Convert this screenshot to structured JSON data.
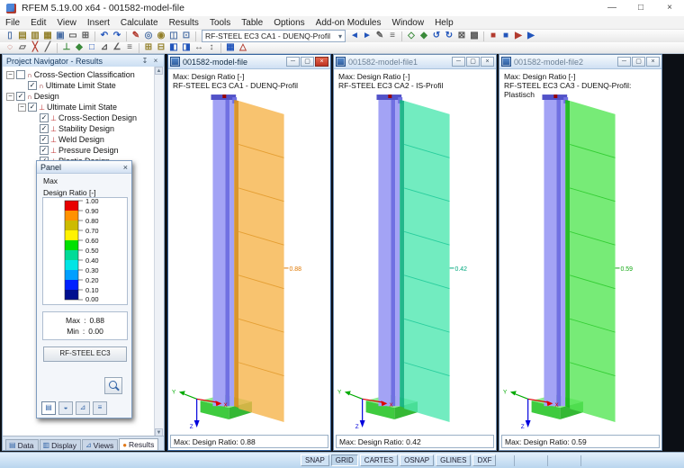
{
  "app": {
    "title": "RFEM 5.19.00 x64 - 001582-model-file",
    "controls": {
      "min": "—",
      "max": "□",
      "close": "×"
    }
  },
  "menu": {
    "items": [
      "File",
      "Edit",
      "View",
      "Insert",
      "Calculate",
      "Results",
      "Tools",
      "Table",
      "Options",
      "Add-on Modules",
      "Window",
      "Help"
    ]
  },
  "toolbar": {
    "case_selector": "RF-STEEL EC3 CA1 - DUENQ-Profil",
    "dd_arrow": "▾",
    "r1": [
      {
        "n": "new-file",
        "g": "▯"
      },
      {
        "n": "open-project",
        "g": "▤"
      },
      {
        "n": "open-model",
        "g": "▥"
      },
      {
        "n": "archive",
        "g": "▦"
      },
      {
        "n": "save",
        "g": "▣"
      },
      {
        "n": "print",
        "g": "▭"
      },
      {
        "n": "copy",
        "g": "⊞"
      },
      {
        "n": "undo",
        "g": "↶"
      },
      {
        "n": "redo",
        "g": "↷"
      },
      {
        "n": "edit",
        "g": "✎"
      },
      {
        "n": "zoom",
        "g": "◎"
      },
      {
        "n": "render-mode",
        "g": "◉"
      },
      {
        "n": "view-split",
        "g": "◫"
      },
      {
        "n": "tables",
        "g": "⊡"
      },
      {
        "n": "prev-case",
        "g": "◄"
      },
      {
        "n": "next-case",
        "g": "►"
      },
      {
        "n": "edit-case",
        "g": "✎"
      },
      {
        "n": "case-list",
        "g": "≡"
      },
      {
        "n": "show-results",
        "g": "◇"
      },
      {
        "n": "result-values",
        "g": "◆"
      },
      {
        "n": "recalculate",
        "g": "↺"
      },
      {
        "n": "refresh",
        "g": "↻"
      },
      {
        "n": "clipping",
        "g": "⊠"
      },
      {
        "n": "grid",
        "g": "▩"
      },
      {
        "n": "module-a",
        "g": "■"
      },
      {
        "n": "module-b",
        "g": "■"
      },
      {
        "n": "module-c",
        "g": "▶"
      },
      {
        "n": "module-d",
        "g": "▶"
      }
    ],
    "r2": [
      {
        "n": "select",
        "g": "◌"
      },
      {
        "n": "select-window",
        "g": "▱"
      },
      {
        "n": "delete",
        "g": "╳"
      },
      {
        "n": "line",
        "g": "╱"
      },
      {
        "n": "member",
        "g": "⊥"
      },
      {
        "n": "node",
        "g": "◆"
      },
      {
        "n": "surface",
        "g": "□"
      },
      {
        "n": "solid",
        "g": "⊿"
      },
      {
        "n": "angle",
        "g": "∠"
      },
      {
        "n": "list",
        "g": "≡"
      },
      {
        "n": "add",
        "g": "⊞"
      },
      {
        "n": "remove",
        "g": "⊟"
      },
      {
        "n": "half-left",
        "g": "◧"
      },
      {
        "n": "half-right",
        "g": "◨"
      },
      {
        "n": "fit-width",
        "g": "↔"
      },
      {
        "n": "fit-height",
        "g": "↕"
      },
      {
        "n": "mesh",
        "g": "▦"
      },
      {
        "n": "triangle",
        "g": "△"
      }
    ]
  },
  "navigator": {
    "title": "Project Navigator - Results",
    "pin": "↧",
    "close": "×",
    "up_arrow": "▲",
    "down_arrow": "▼",
    "rows": [
      {
        "label": "Cross-Section Classification"
      },
      {
        "label": "Ultimate Limit State"
      },
      {
        "label": "Design"
      },
      {
        "label": "Ultimate Limit State"
      },
      {
        "label": "Cross-Section Design"
      },
      {
        "label": "Stability Design"
      },
      {
        "label": "Weld Design"
      },
      {
        "label": "Pressure Design"
      },
      {
        "label": "Plastic Design"
      }
    ],
    "glyphs": {
      "arch": "∩",
      "uls": "⊥",
      "check": "✓",
      "minus": "−"
    },
    "tabs": [
      {
        "label": "Data",
        "icon": "▤"
      },
      {
        "label": "Display",
        "icon": "▥"
      },
      {
        "label": "Views",
        "icon": "⊿"
      },
      {
        "label": "Results",
        "icon": "●"
      }
    ]
  },
  "panel": {
    "title": "Panel",
    "close": "×",
    "quantity": "Max",
    "unit_label": "Design Ratio [-]",
    "scale": {
      "colors": [
        "#E80000",
        "#FF9100",
        "#CDBB00",
        "#FFF200",
        "#00E100",
        "#00DB97",
        "#00E5E5",
        "#009FFF",
        "#0021FF",
        "#000E8F"
      ],
      "ticks": [
        "1.00",
        "0.90",
        "0.80",
        "0.70",
        "0.60",
        "0.50",
        "0.40",
        "0.30",
        "0.20",
        "0.10",
        "0.00"
      ]
    },
    "max_label": "Max",
    "max_sep": ":",
    "max_value": "0.88",
    "min_label": "Min",
    "min_sep": ":",
    "min_value": "0.00",
    "module_button": "RF-STEEL EC3",
    "tabs": [
      {
        "n": "color-scale",
        "g": "▤"
      },
      {
        "n": "factors",
        "g": "◒"
      },
      {
        "n": "views",
        "g": "⊿"
      },
      {
        "n": "layers",
        "g": "≡"
      }
    ]
  },
  "win_btns": {
    "min": "─",
    "restore": "▢",
    "close": "×"
  },
  "model": {
    "column_light": "#A3A3F5",
    "column_mid": "#7070E2",
    "column_dark": "#5252C8",
    "marker": "#990000",
    "foundation_top": "#90EC90",
    "foundation_front": "#3FCB3F",
    "foundation_side": "#35B835",
    "axis_x": "#DD0000",
    "axis_y": "#00AA00",
    "axis_z": "#0000DD",
    "axes": {
      "x": "X",
      "y": "Y",
      "z": "Z"
    }
  },
  "windows": [
    {
      "title": "001582-model-file",
      "info_line1": "Max: Design Ratio [-]",
      "info_line2": "RF-STEEL EC3 CA1 - DUENQ-Profil",
      "status": "Max: Design Ratio: 0.88",
      "band": {
        "fill": "#F6B44B",
        "edge": "#D89020",
        "line": "#E09828",
        "label": "0.88",
        "label_color": "#E07800"
      }
    },
    {
      "title": "001582-model-file1",
      "info_line1": "Max: Design Ratio [-]",
      "info_line2": "RF-STEEL EC3 CA2 - IS-Profil",
      "status": "Max: Design Ratio: 0.42",
      "band": {
        "fill": "#4FE7B0",
        "edge": "#16B385",
        "line": "#1CC896",
        "label": "0.42",
        "label_color": "#00A87E"
      }
    },
    {
      "title": "001582-model-file2",
      "info_line1": "Max: Design Ratio [-]",
      "info_line2": "RF-STEEL EC3 CA3 - DUENQ-Profil: Plastisch",
      "status": "Max: Design Ratio: 0.59",
      "band": {
        "fill": "#55E655",
        "edge": "#1CB81C",
        "line": "#28C828",
        "label": "0.59",
        "label_color": "#12A812"
      }
    }
  ],
  "statusbar": {
    "buttons": [
      "SNAP",
      "GRID",
      "CARTES",
      "OSNAP",
      "GLINES",
      "DXF"
    ]
  }
}
